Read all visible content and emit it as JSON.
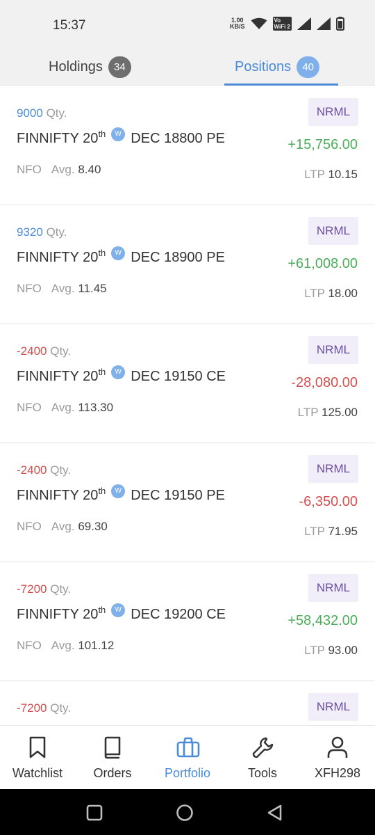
{
  "status_bar": {
    "time": "15:37",
    "speed_value": "1.00",
    "speed_unit": "KB/S",
    "volte_line1": "Vo",
    "volte_line2": "WiFi 2"
  },
  "tabs": {
    "holdings_label": "Holdings",
    "holdings_count": "34",
    "positions_label": "Positions",
    "positions_count": "40"
  },
  "positions": [
    {
      "qty": "9000",
      "qty_label": "Qty.",
      "name": "FINNIFTY 20",
      "sup": "th",
      "weekly": "W",
      "contract": "DEC 18800 PE",
      "exchange": "NFO",
      "avg_label": "Avg.",
      "avg": "8.40",
      "product": "NRML",
      "pnl": "+15,756.00",
      "ltp_label": "LTP",
      "ltp": "10.15"
    },
    {
      "qty": "9320",
      "qty_label": "Qty.",
      "name": "FINNIFTY 20",
      "sup": "th",
      "weekly": "W",
      "contract": "DEC 18900 PE",
      "exchange": "NFO",
      "avg_label": "Avg.",
      "avg": "11.45",
      "product": "NRML",
      "pnl": "+61,008.00",
      "ltp_label": "LTP",
      "ltp": "18.00"
    },
    {
      "qty": "-2400",
      "qty_label": "Qty.",
      "name": "FINNIFTY 20",
      "sup": "th",
      "weekly": "W",
      "contract": "DEC 19150 CE",
      "exchange": "NFO",
      "avg_label": "Avg.",
      "avg": "113.30",
      "product": "NRML",
      "pnl": "-28,080.00",
      "ltp_label": "LTP",
      "ltp": "125.00"
    },
    {
      "qty": "-2400",
      "qty_label": "Qty.",
      "name": "FINNIFTY 20",
      "sup": "th",
      "weekly": "W",
      "contract": "DEC 19150 PE",
      "exchange": "NFO",
      "avg_label": "Avg.",
      "avg": "69.30",
      "product": "NRML",
      "pnl": "-6,350.00",
      "ltp_label": "LTP",
      "ltp": "71.95"
    },
    {
      "qty": "-7200",
      "qty_label": "Qty.",
      "name": "FINNIFTY 20",
      "sup": "th",
      "weekly": "W",
      "contract": "DEC 19200 CE",
      "exchange": "NFO",
      "avg_label": "Avg.",
      "avg": "101.12",
      "product": "NRML",
      "pnl": "+58,432.00",
      "ltp_label": "LTP",
      "ltp": "93.00"
    },
    {
      "qty": "-7200",
      "qty_label": "Qty.",
      "name": "",
      "sup": "",
      "weekly": "",
      "contract": "",
      "exchange": "",
      "avg_label": "",
      "avg": "",
      "product": "NRML",
      "pnl": "",
      "ltp_label": "",
      "ltp": ""
    }
  ],
  "bottom_nav": {
    "watchlist": "Watchlist",
    "orders": "Orders",
    "portfolio": "Portfolio",
    "tools": "Tools",
    "profile": "XFH298"
  },
  "colors": {
    "accent": "#4a8ad6",
    "gain": "#4cad5a",
    "loss": "#d2514f",
    "product_tag_bg": "#f2eef9",
    "product_tag_text": "#6b4fa1"
  },
  "icons": [
    "wifi-icon",
    "signal-icon",
    "battery-icon",
    "bookmark-icon",
    "book-icon",
    "briefcase-icon",
    "wrench-icon",
    "user-icon",
    "square-icon",
    "circle-icon",
    "back-triangle-icon"
  ]
}
